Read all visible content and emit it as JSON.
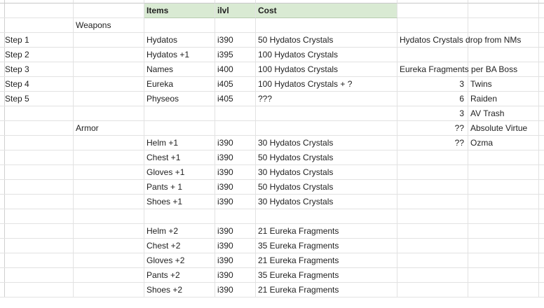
{
  "sheet": {
    "rows": [
      [
        "",
        "",
        "Items",
        "ilvl",
        "Cost",
        "",
        ""
      ],
      [
        "",
        "Weapons",
        "",
        "",
        "",
        "",
        ""
      ],
      [
        "Step 1",
        "",
        "Hydatos",
        "i390",
        "50 Hydatos Crystals",
        "Hydatos Crystals drop from NMs",
        ""
      ],
      [
        "Step 2",
        "",
        "Hydatos +1",
        "i395",
        "100 Hydatos Crystals",
        "",
        ""
      ],
      [
        "Step 3",
        "",
        "Names",
        "i400",
        "100 Hydatos Crystals",
        "Eureka Fragments per  BA Boss",
        ""
      ],
      [
        "Step 4",
        "",
        "Eureka",
        "i405",
        "100 Hydatos Crystals + ?",
        "3",
        "Twins"
      ],
      [
        "Step 5",
        "",
        "Physeos",
        "i405",
        "???",
        "6",
        "Raiden"
      ],
      [
        "",
        "",
        "",
        "",
        "",
        "3",
        "AV Trash"
      ],
      [
        "",
        "Armor",
        "",
        "",
        "",
        "??",
        "Absolute Virtue"
      ],
      [
        "",
        "",
        "Helm +1",
        "i390",
        "30 Hydatos Crystals",
        "??",
        "Ozma"
      ],
      [
        "",
        "",
        "Chest +1",
        "i390",
        "50 Hydatos Crystals",
        "",
        ""
      ],
      [
        "",
        "",
        "Gloves +1",
        "i390",
        "30 Hydatos Crystals",
        "",
        ""
      ],
      [
        "",
        "",
        "Pants + 1",
        "i390",
        "50 Hydatos Crystals",
        "",
        ""
      ],
      [
        "",
        "",
        "Shoes +1",
        "i390",
        "30 Hydatos Crystals",
        "",
        ""
      ],
      [
        "",
        "",
        "",
        "",
        "",
        "",
        ""
      ],
      [
        "",
        "",
        "Helm +2",
        "i390",
        "21 Eureka Fragments",
        "",
        ""
      ],
      [
        "",
        "",
        "Chest +2",
        "i390",
        "35 Eureka Fragments",
        "",
        ""
      ],
      [
        "",
        "",
        "Gloves +2",
        "i390",
        "21 Eureka Fragments",
        "",
        ""
      ],
      [
        "",
        "",
        "Pants +2",
        "i390",
        "35 Eureka Fragments",
        "",
        ""
      ],
      [
        "",
        "",
        "Shoes +2",
        "i390",
        "21 Eureka Fragments",
        "",
        ""
      ]
    ]
  }
}
